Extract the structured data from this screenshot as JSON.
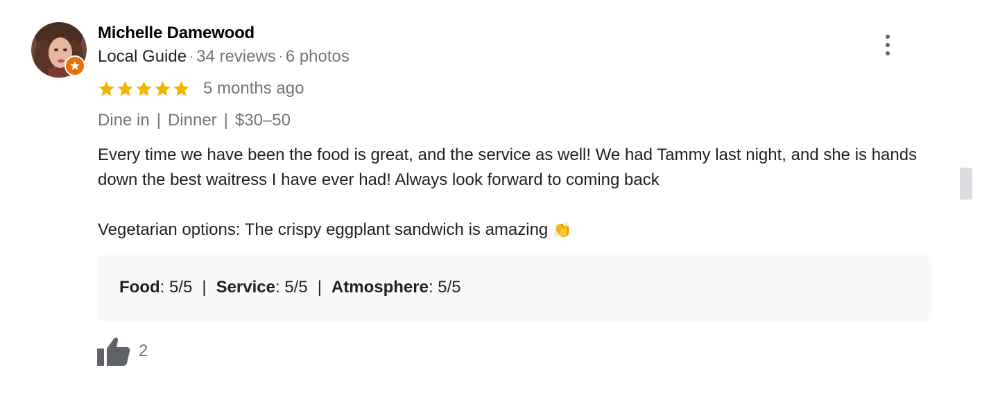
{
  "reviewer": {
    "name": "Michelle Damewood",
    "badge": "Local Guide",
    "reviews": "34 reviews",
    "photos": "6 photos",
    "separator": "·"
  },
  "rating": {
    "stars": 5,
    "max": 5,
    "date": "5 months ago",
    "star_color": "#f4b400"
  },
  "visit": {
    "service": "Dine in",
    "meal": "Dinner",
    "price": "$30–50",
    "separator": "|"
  },
  "review": {
    "paragraph1": "Every time we have been the food is great, and the service as well! We had Tammy last night, and she is hands down the best waitress I have ever had! Always look forward to coming back",
    "paragraph2": "Vegetarian options: The crispy eggplant sandwich is amazing",
    "emoji": "👏"
  },
  "subratings": {
    "food_label": "Food",
    "food_value": ": 5/5",
    "service_label": "Service",
    "service_value": ": 5/5",
    "atmosphere_label": "Atmosphere",
    "atmosphere_value": ": 5/5",
    "separator": "|"
  },
  "likes": {
    "count": "2",
    "icon": "thumbs-up-icon"
  },
  "colors": {
    "badge_orange": "#e8710a",
    "muted_text": "#70757a",
    "panel_bg": "#f8f9fa"
  }
}
